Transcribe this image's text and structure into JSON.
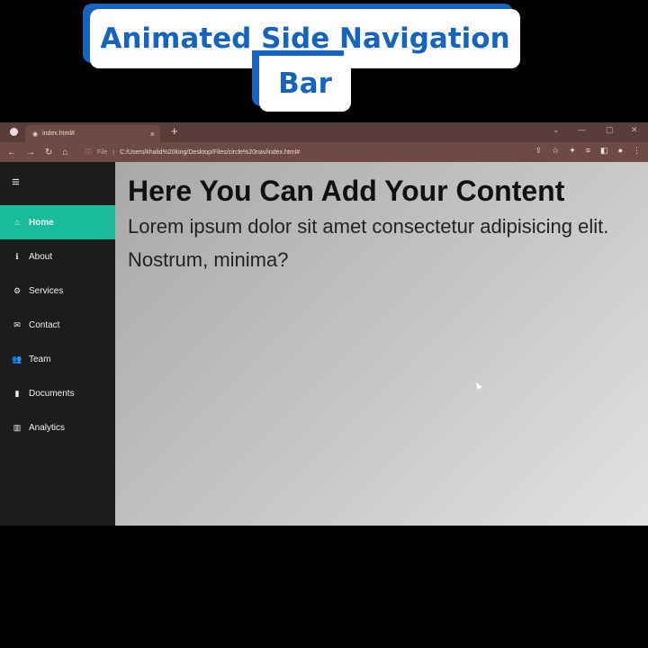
{
  "banner": {
    "line1": "Animated Side Navigation",
    "line2": "Bar"
  },
  "browser": {
    "tab_title": "index.html#",
    "tab_close": "×",
    "new_tab": "+",
    "url_prefix": "File",
    "url": "C:/Users/khalid%20king/Desktop/Files/circle%20nav/index.html#"
  },
  "sidebar": {
    "menu_icon": "≡",
    "items": [
      {
        "label": "Home",
        "icon": "home-icon",
        "glyph": "⌂",
        "active": true
      },
      {
        "label": "About",
        "icon": "info-icon",
        "glyph": "ℹ",
        "active": false
      },
      {
        "label": "Services",
        "icon": "gears-icon",
        "glyph": "⚙",
        "active": false
      },
      {
        "label": "Contact",
        "icon": "envelope-icon",
        "glyph": "✉",
        "active": false
      },
      {
        "label": "Team",
        "icon": "users-icon",
        "glyph": "👥",
        "active": false
      },
      {
        "label": "Documents",
        "icon": "file-icon",
        "glyph": "▮",
        "active": false
      },
      {
        "label": "Analytics",
        "icon": "chart-icon",
        "glyph": "▥",
        "active": false
      }
    ]
  },
  "content": {
    "heading": "Here You Can Add Your Content",
    "body": "Lorem ipsum dolor sit amet consectetur adipisicing elit. Nostrum, minima?"
  },
  "colors": {
    "accent": "#1abc9c",
    "sidebar_bg": "#1c1c1c",
    "banner_text": "#1565c0"
  }
}
